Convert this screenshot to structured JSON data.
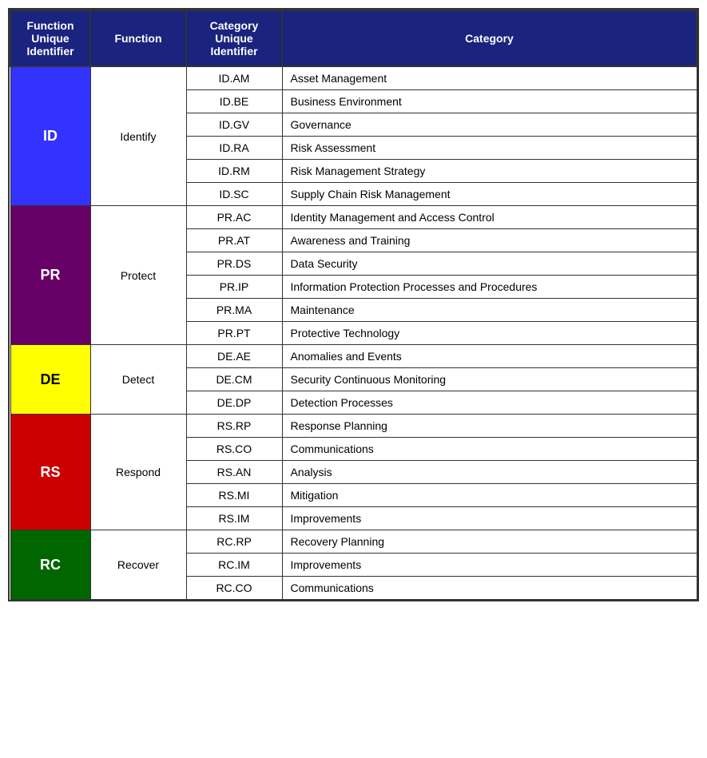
{
  "table": {
    "headers": [
      {
        "label": "Function\nUnique\nIdentifier",
        "key": "func-uid-header"
      },
      {
        "label": "Function",
        "key": "function-header"
      },
      {
        "label": "Category\nUnique\nIdentifier",
        "key": "cat-uid-header"
      },
      {
        "label": "Category",
        "key": "category-header"
      }
    ],
    "groups": [
      {
        "funcUID": "ID",
        "function": "Identify",
        "bgClass": "bg-blue",
        "rows": [
          {
            "catUID": "ID.AM",
            "category": "Asset Management"
          },
          {
            "catUID": "ID.BE",
            "category": "Business Environment"
          },
          {
            "catUID": "ID.GV",
            "category": "Governance"
          },
          {
            "catUID": "ID.RA",
            "category": "Risk Assessment"
          },
          {
            "catUID": "ID.RM",
            "category": "Risk Management Strategy"
          },
          {
            "catUID": "ID.SC",
            "category": "Supply Chain Risk Management"
          }
        ]
      },
      {
        "funcUID": "PR",
        "function": "Protect",
        "bgClass": "bg-purple",
        "rows": [
          {
            "catUID": "PR.AC",
            "category": "Identity Management and Access Control"
          },
          {
            "catUID": "PR.AT",
            "category": "Awareness and Training"
          },
          {
            "catUID": "PR.DS",
            "category": "Data Security"
          },
          {
            "catUID": "PR.IP",
            "category": "Information Protection Processes and Procedures"
          },
          {
            "catUID": "PR.MA",
            "category": "Maintenance"
          },
          {
            "catUID": "PR.PT",
            "category": "Protective Technology"
          }
        ]
      },
      {
        "funcUID": "DE",
        "function": "Detect",
        "bgClass": "bg-yellow",
        "rows": [
          {
            "catUID": "DE.AE",
            "category": "Anomalies and Events"
          },
          {
            "catUID": "DE.CM",
            "category": "Security Continuous Monitoring"
          },
          {
            "catUID": "DE.DP",
            "category": "Detection Processes"
          }
        ]
      },
      {
        "funcUID": "RS",
        "function": "Respond",
        "bgClass": "bg-red",
        "rows": [
          {
            "catUID": "RS.RP",
            "category": "Response Planning"
          },
          {
            "catUID": "RS.CO",
            "category": "Communications"
          },
          {
            "catUID": "RS.AN",
            "category": "Analysis"
          },
          {
            "catUID": "RS.MI",
            "category": "Mitigation"
          },
          {
            "catUID": "RS.IM",
            "category": "Improvements"
          }
        ]
      },
      {
        "funcUID": "RC",
        "function": "Recover",
        "bgClass": "bg-green",
        "rows": [
          {
            "catUID": "RC.RP",
            "category": "Recovery Planning"
          },
          {
            "catUID": "RC.IM",
            "category": "Improvements"
          },
          {
            "catUID": "RC.CO",
            "category": "Communications"
          }
        ]
      }
    ]
  }
}
